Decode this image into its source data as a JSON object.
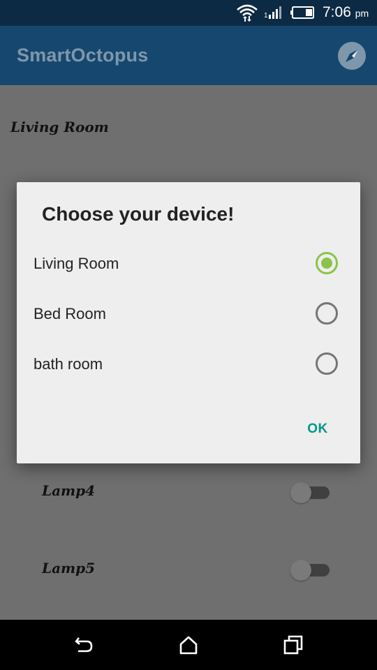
{
  "status_bar": {
    "time": "7:06",
    "ampm": "pm",
    "icons": [
      "wifi-icon",
      "signal-icon",
      "battery-icon"
    ]
  },
  "toolbar": {
    "title": "SmartOctopus",
    "action_icon": "compass-icon"
  },
  "background": {
    "section_title": "Living Room",
    "lamps": [
      {
        "label": "Lamp4",
        "on": false
      },
      {
        "label": "Lamp5",
        "on": false
      }
    ]
  },
  "dialog": {
    "title": "Choose your device!",
    "options": [
      {
        "label": "Living Room",
        "selected": true
      },
      {
        "label": "Bed Room",
        "selected": false
      },
      {
        "label": "bath room",
        "selected": false
      }
    ],
    "ok_label": "OK"
  },
  "nav_bar": {
    "buttons": [
      "back-icon",
      "home-icon",
      "recents-icon"
    ]
  },
  "colors": {
    "status_bar": "#0d2a44",
    "toolbar": "#16476f",
    "scrim_background": "#6f6f6f",
    "dialog_background": "#eeeeee",
    "radio_selected": "#8bc34a",
    "ok_text": "#009688"
  }
}
